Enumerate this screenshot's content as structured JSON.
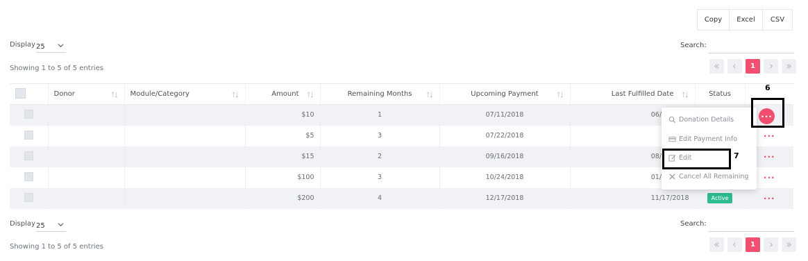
{
  "export_buttons": [
    "Copy",
    "Excel",
    "CSV"
  ],
  "length": {
    "label": "Display",
    "value": "25"
  },
  "search": {
    "label": "Search:",
    "value": ""
  },
  "info": "Showing 1 to 5 of 5 entries",
  "pagination": {
    "current": "1"
  },
  "columns": [
    "Donor",
    "Module/Category",
    "Amount",
    "Remaining Months",
    "Upcoming Payment",
    "Last Fulfilled Date",
    "Status"
  ],
  "rows": [
    {
      "donor": "",
      "module": "",
      "amount": "$10",
      "remaining": "1",
      "upcoming": "07/11/2018",
      "last": "06/26/2018",
      "status": ""
    },
    {
      "donor": "",
      "module": "",
      "amount": "$5",
      "remaining": "3",
      "upcoming": "07/22/2018",
      "last": "",
      "status": ""
    },
    {
      "donor": "",
      "module": "",
      "amount": "$15",
      "remaining": "2",
      "upcoming": "09/16/2018",
      "last": "08/16/2018",
      "status": ""
    },
    {
      "donor": "",
      "module": "",
      "amount": "$100",
      "remaining": "3",
      "upcoming": "10/24/2018",
      "last": "01/29/2019",
      "status": ""
    },
    {
      "donor": "",
      "module": "",
      "amount": "$200",
      "remaining": "4",
      "upcoming": "12/17/2018",
      "last": "11/17/2018",
      "status": "Active"
    }
  ],
  "row_action_glyph": "···",
  "menu": {
    "items": [
      "Donation Details",
      "Edit Payment Info",
      "Edit",
      "Cancel All Remaining"
    ],
    "icons": [
      "search-icon",
      "credit-card-icon",
      "edit-icon",
      "close-icon"
    ]
  },
  "annotations": {
    "action_marker": "6",
    "edit_marker": "7"
  },
  "colors": {
    "accent": "#f0506e",
    "active_badge": "#2dbb8f",
    "row_stripe": "#f1f2f5"
  }
}
